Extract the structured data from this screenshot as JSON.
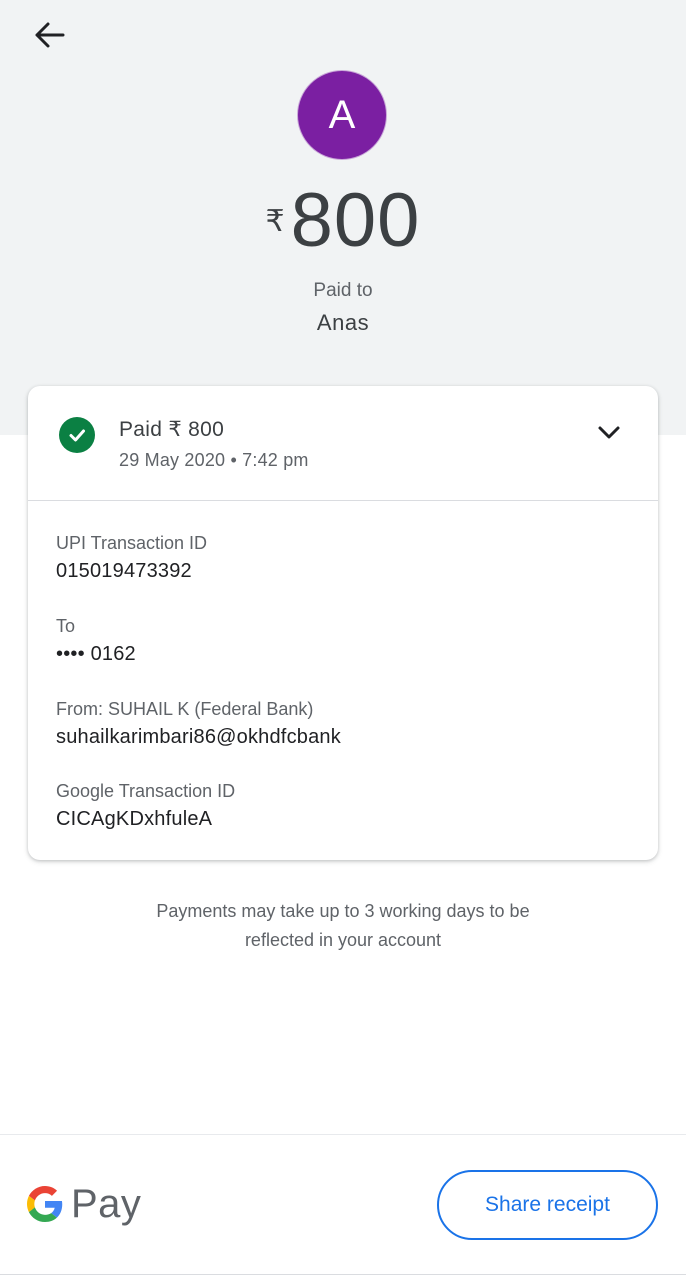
{
  "header": {
    "avatar_letter": "A",
    "currency_symbol": "₹",
    "amount": "800",
    "paid_to_label": "Paid to",
    "payee_name": "Anas"
  },
  "card": {
    "status": "Paid ₹ 800",
    "datetime": "29 May 2020 • 7:42 pm",
    "fields": [
      {
        "label": "UPI Transaction ID",
        "value": "015019473392"
      },
      {
        "label": "To",
        "value": "•••• 0162"
      },
      {
        "label": "From: SUHAIL K (Federal Bank)",
        "value": "suhailkarimbari86@okhdfcbank"
      },
      {
        "label": "Google Transaction ID",
        "value": "CICAgKDxhfuleA"
      }
    ]
  },
  "note": {
    "line1": "Payments may take up to 3 working days to be",
    "line2": "reflected in your account"
  },
  "footer": {
    "brand_text": "Pay",
    "share_label": "Share receipt"
  },
  "colors": {
    "avatar": "#7b1fa2",
    "success": "#0b8043",
    "accent": "#1a73e8",
    "top_band": "#f1f3f4"
  },
  "icons": [
    "arrow-back-icon",
    "check-circle-icon",
    "chevron-down-icon",
    "google-g-logo"
  ]
}
